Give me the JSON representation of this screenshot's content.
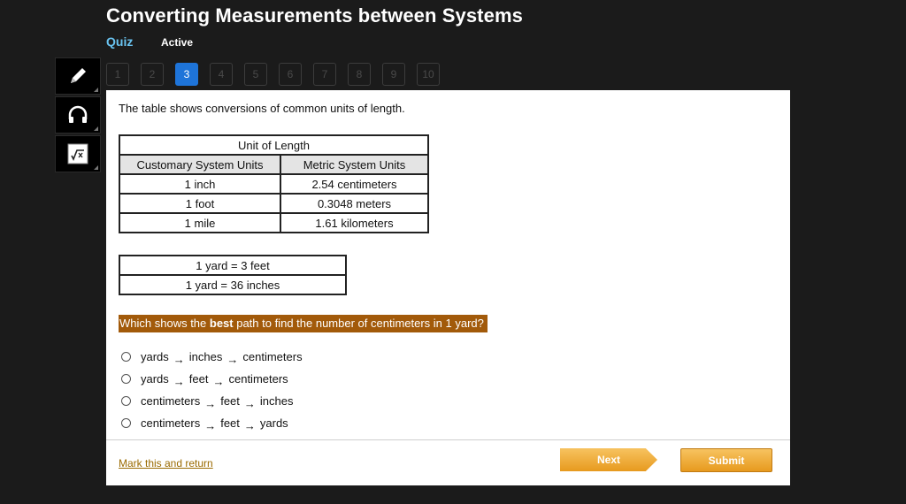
{
  "header": {
    "title": "Converting Measurements between Systems",
    "mode": "Quiz",
    "status": "Active"
  },
  "toolbar": {
    "tools": [
      {
        "icon": "pencil-icon"
      },
      {
        "icon": "headphones-icon"
      },
      {
        "icon": "calculator-icon"
      }
    ]
  },
  "question_nav": {
    "numbers": [
      "1",
      "2",
      "3",
      "4",
      "5",
      "6",
      "7",
      "8",
      "9",
      "10"
    ],
    "current": "3"
  },
  "content": {
    "intro": "The table shows conversions of common units of length.",
    "conversion_table": {
      "title": "Unit of Length",
      "headers": [
        "Customary System Units",
        "Metric System Units"
      ],
      "rows": [
        [
          "1 inch",
          "2.54 centimeters"
        ],
        [
          "1 foot",
          "0.3048 meters"
        ],
        [
          "1 mile",
          "1.61 kilometers"
        ]
      ]
    },
    "yard_table": [
      "1 yard = 3 feet",
      "1 yard = 36 inches"
    ],
    "question": {
      "before": "Which shows the ",
      "bold": "best",
      "after": " path to find the number of centimeters in 1 yard?"
    },
    "arrow": "→",
    "options": [
      [
        "yards",
        "inches",
        "centimeters"
      ],
      [
        "yards",
        "feet",
        "centimeters"
      ],
      [
        "centimeters",
        "feet",
        "inches"
      ],
      [
        "centimeters",
        "feet",
        "yards"
      ]
    ]
  },
  "footer": {
    "mark_label": "Mark this and return",
    "next_label": "Next",
    "submit_label": "Submit"
  },
  "colors": {
    "accent_blue": "#1e74d9",
    "question_bg": "#a25a0a",
    "button_orange": "#f0ad3c"
  }
}
